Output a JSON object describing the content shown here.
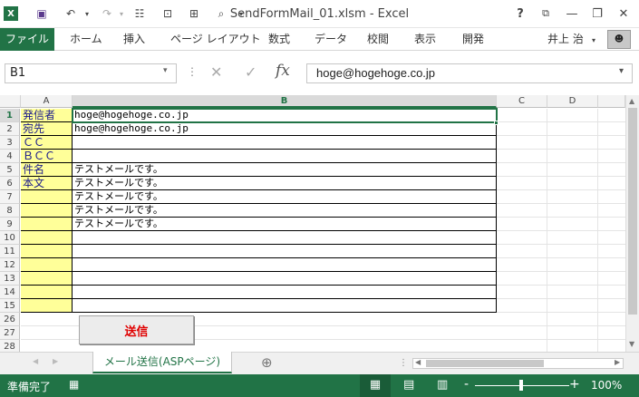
{
  "window": {
    "title": "SendFormMail_01.xlsm - Excel",
    "help": "?",
    "user": "井上 治"
  },
  "ribbon": {
    "tabs": [
      "ファイル",
      "ホーム",
      "挿入",
      "ページ レイアウト",
      "数式",
      "データ",
      "校閲",
      "表示",
      "開発"
    ]
  },
  "formula_bar": {
    "name_box": "B1",
    "fx": "fx",
    "value": "hoge@hogehoge.co.jp"
  },
  "columns": [
    "A",
    "B",
    "C",
    "D"
  ],
  "rows": [
    {
      "num": "1",
      "label": "発信者",
      "value": "hoge@hogehoge.co.jp"
    },
    {
      "num": "2",
      "label": "宛先",
      "value": "hoge@hogehoge.co.jp"
    },
    {
      "num": "3",
      "label": "ＣＣ",
      "value": ""
    },
    {
      "num": "4",
      "label": "ＢＣＣ",
      "value": ""
    },
    {
      "num": "5",
      "label": "件名",
      "value": "テストメールです。"
    },
    {
      "num": "6",
      "label": "本文",
      "value": "テストメールです。"
    },
    {
      "num": "7",
      "label": "",
      "value": "テストメールです。"
    },
    {
      "num": "8",
      "label": "",
      "value": "テストメールです。"
    },
    {
      "num": "9",
      "label": "",
      "value": "テストメールです。"
    },
    {
      "num": "10",
      "label": "",
      "value": ""
    },
    {
      "num": "11",
      "label": "",
      "value": ""
    },
    {
      "num": "12",
      "label": "",
      "value": ""
    },
    {
      "num": "13",
      "label": "",
      "value": ""
    },
    {
      "num": "14",
      "label": "",
      "value": ""
    },
    {
      "num": "15",
      "label": "",
      "value": ""
    }
  ],
  "extra_rows": [
    "26",
    "27",
    "28"
  ],
  "send_button": {
    "label": "送信",
    "color": "#e00000"
  },
  "sheet_tab": "メール送信(ASPページ)",
  "add_sheet": "⊕",
  "status": {
    "ready": "準備完了",
    "zoom": "100%",
    "zoom_minus": "-",
    "zoom_plus": "+"
  },
  "colors": {
    "accent": "#217346",
    "label_fill": "#ffff99"
  }
}
